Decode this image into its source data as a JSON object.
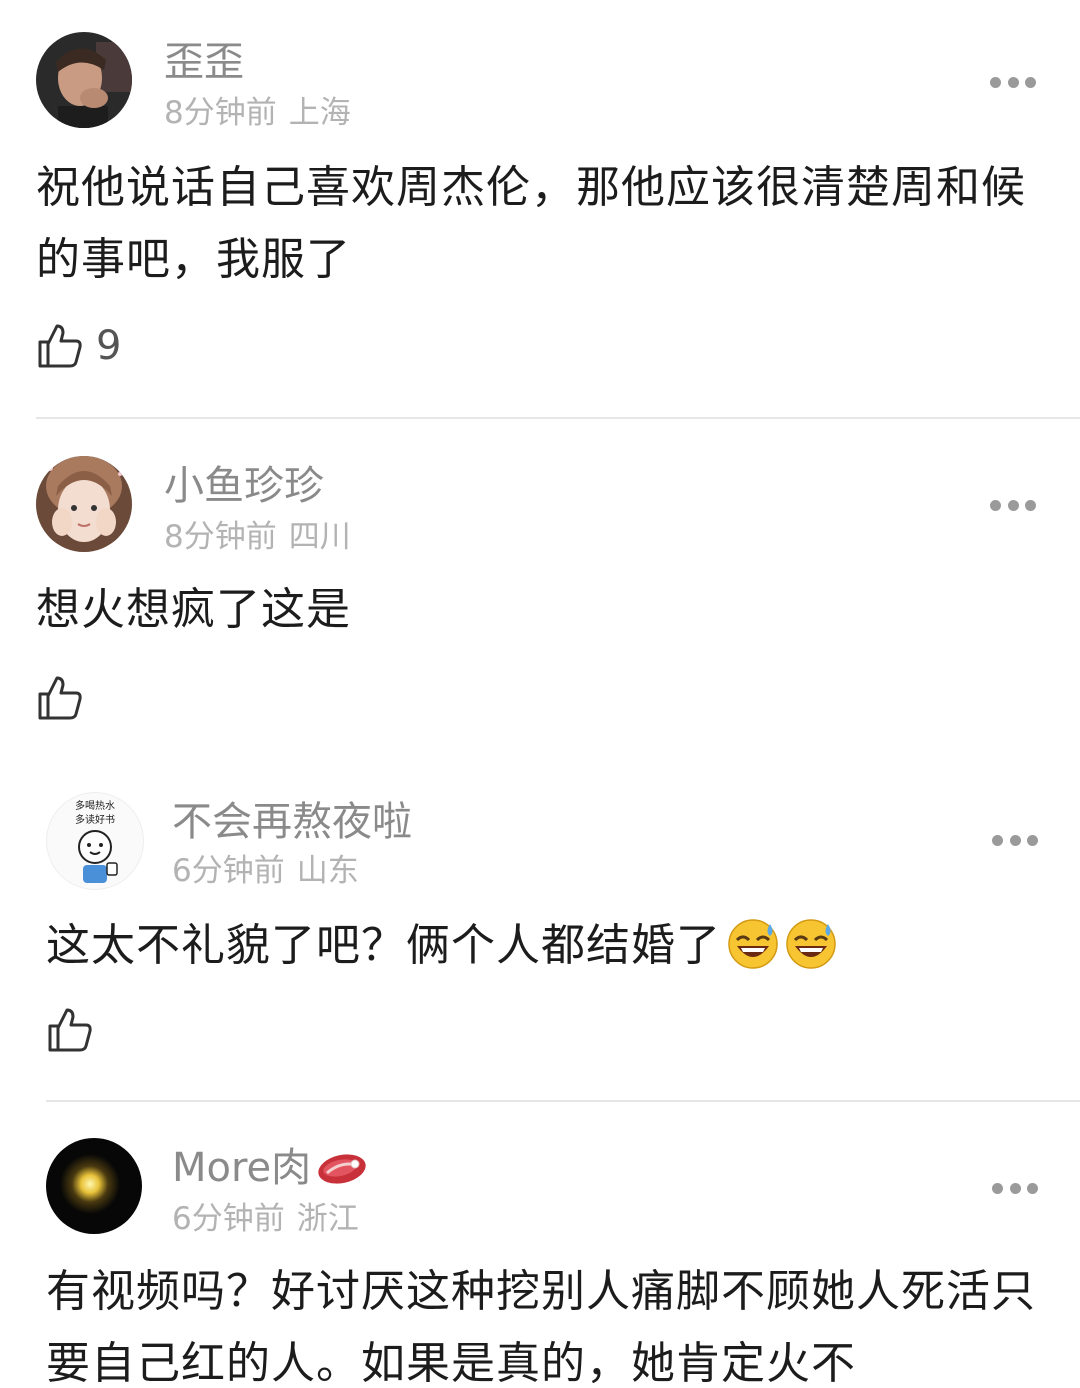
{
  "comments": [
    {
      "username": "歪歪",
      "time": "8分钟前",
      "location": "上海",
      "text": "祝他说话自己喜欢周杰伦，那他应该很清楚周和候的事吧，我服了",
      "likes": "9"
    },
    {
      "username": "小鱼珍珍",
      "time": "8分钟前",
      "location": "四川",
      "text": "想火想疯了这是",
      "likes": ""
    },
    {
      "username": "不会再熬夜啦",
      "avatar_text_1": "多喝热水",
      "avatar_text_2": "多读好书",
      "time": "6分钟前",
      "location": "山东",
      "text": "这太不礼貌了吧？俩个人都结婚了",
      "likes": ""
    },
    {
      "username": "More肉",
      "time": "6分钟前",
      "location": "浙江",
      "text": "有视频吗？好讨厌这种挖别人痛脚不顾她人死活只要自己红的人。如果是真的，她肯定火不"
    }
  ],
  "icons": {
    "like": "thumbs-up-icon",
    "more": "more-dots-icon",
    "emoji": "grinning-sweat-emoji",
    "meat": "meat-emoji"
  },
  "colors": {
    "username": "#8a8a8a",
    "meta": "#b3b3b3",
    "text": "#1c1c1c",
    "divider": "#e6e6e6"
  }
}
